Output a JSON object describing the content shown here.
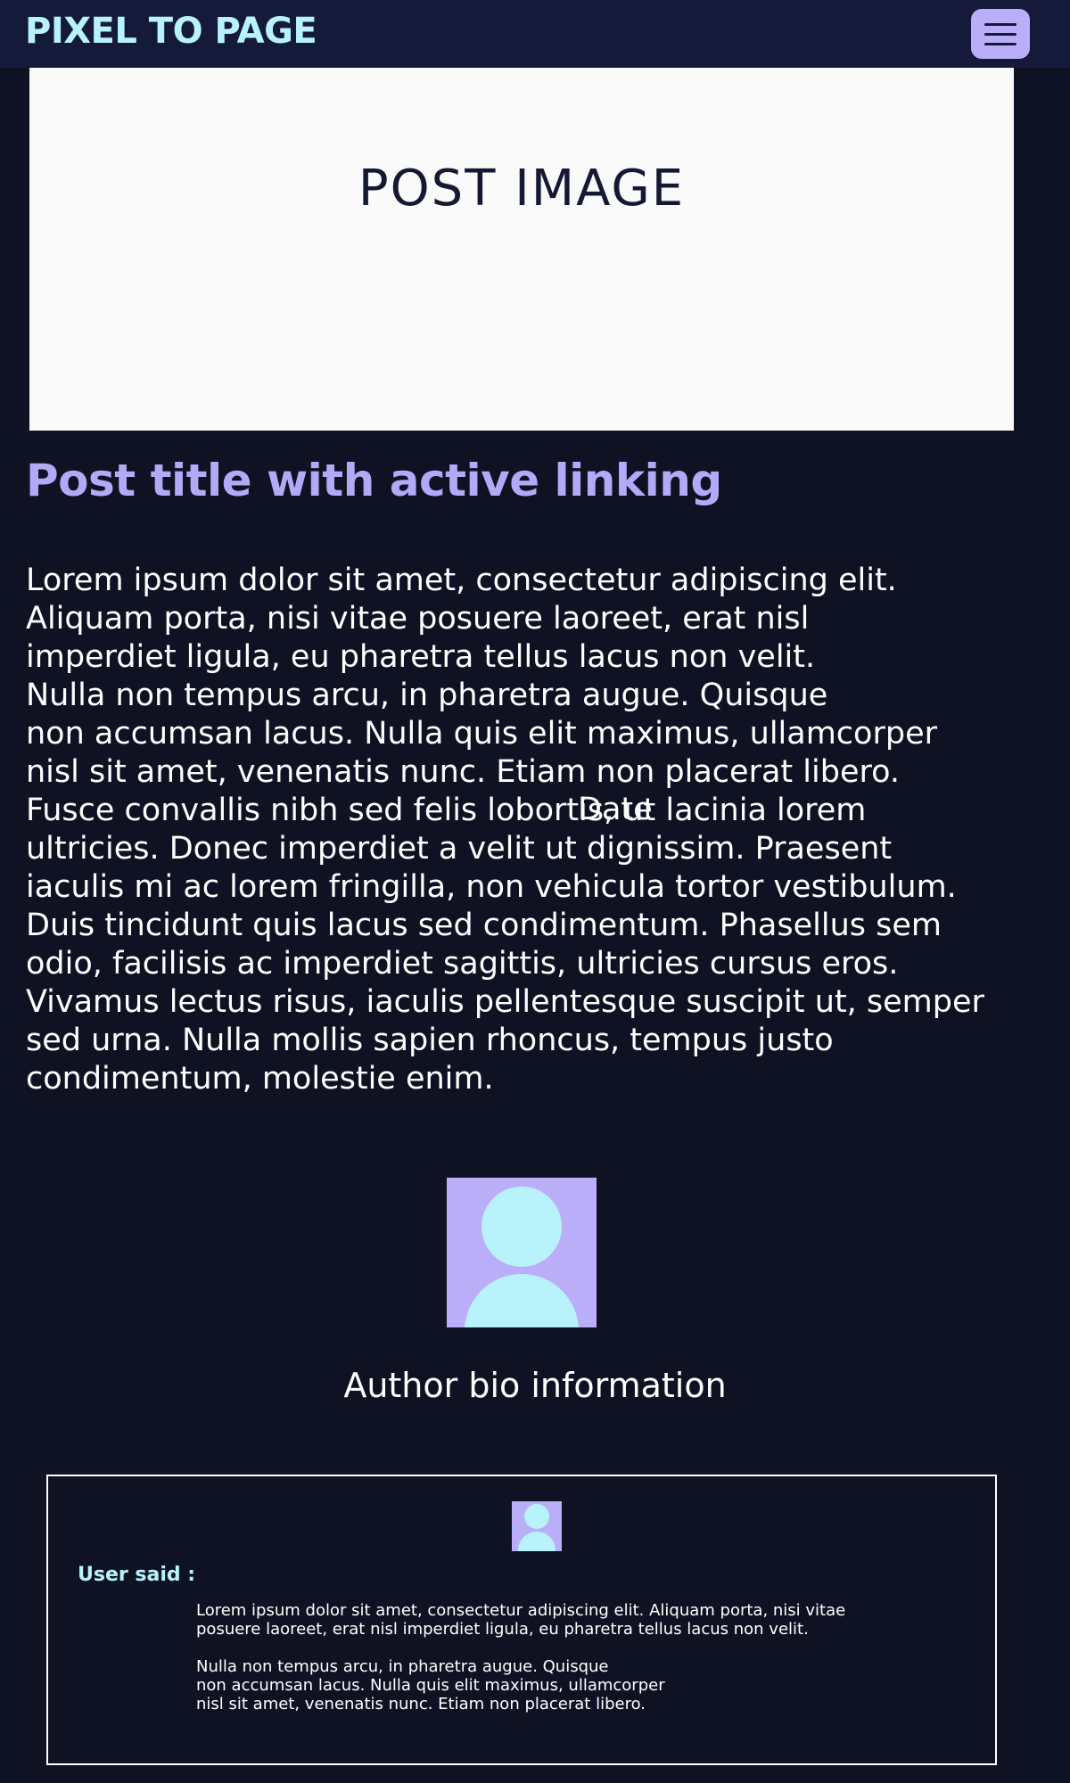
{
  "navbar": {
    "brand": "PIXEL TO PAGE",
    "menu_icon": "hamburger-menu-icon"
  },
  "post": {
    "image_label": "POST IMAGE",
    "title": "Post title with active linking",
    "body": " Lorem ipsum dolor sit amet, consectetur adipiscing elit.\nAliquam porta, nisi vitae posuere laoreet, erat nisl\nimperdiet ligula, eu pharetra tellus lacus non velit.\nNulla non tempus arcu, in pharetra augue. Quisque\nnon accumsan lacus. Nulla quis elit maximus, ullamcorper\nnisl sit amet, venenatis nunc. Etiam non placerat libero.\nFusce convallis nibh sed felis lobortis, ut lacinia lorem\nultricies. Donec imperdiet a velit ut dignissim. Praesent\niaculis mi ac lorem fringilla, non vehicula tortor vestibulum.\nDuis tincidunt quis lacus sed condimentum. Phasellus sem\nodio, facilisis ac imperdiet sagittis, ultricies cursus eros.\nVivamus lectus risus, iaculis pellentesque suscipit ut, semper\nsed urna. Nulla mollis sapien rhoncus, tempus justo\ncondimentum, molestie enim.",
    "date": "Date"
  },
  "author": {
    "avatar_icon": "user-avatar-icon",
    "bio": "Author bio information"
  },
  "comment": {
    "avatar_icon": "user-avatar-icon",
    "label": "User said :",
    "text": " Lorem ipsum dolor sit amet, consectetur adipiscing elit. Aliquam porta, nisi vitae\nposuere laoreet, erat nisl imperdiet ligula, eu pharetra tellus lacus non velit.\n\nNulla non tempus arcu, in pharetra augue. Quisque\nnon accumsan lacus. Nulla quis elit maximus, ullamcorper\nnisl sit amet, venenatis nunc. Etiam non placerat libero."
  },
  "colors": {
    "background": "#0f1223",
    "navbar": "#161a3a",
    "brand_accent": "#b8f3fb",
    "purple_accent": "#bbaef9",
    "title": "#b3a9f6"
  }
}
